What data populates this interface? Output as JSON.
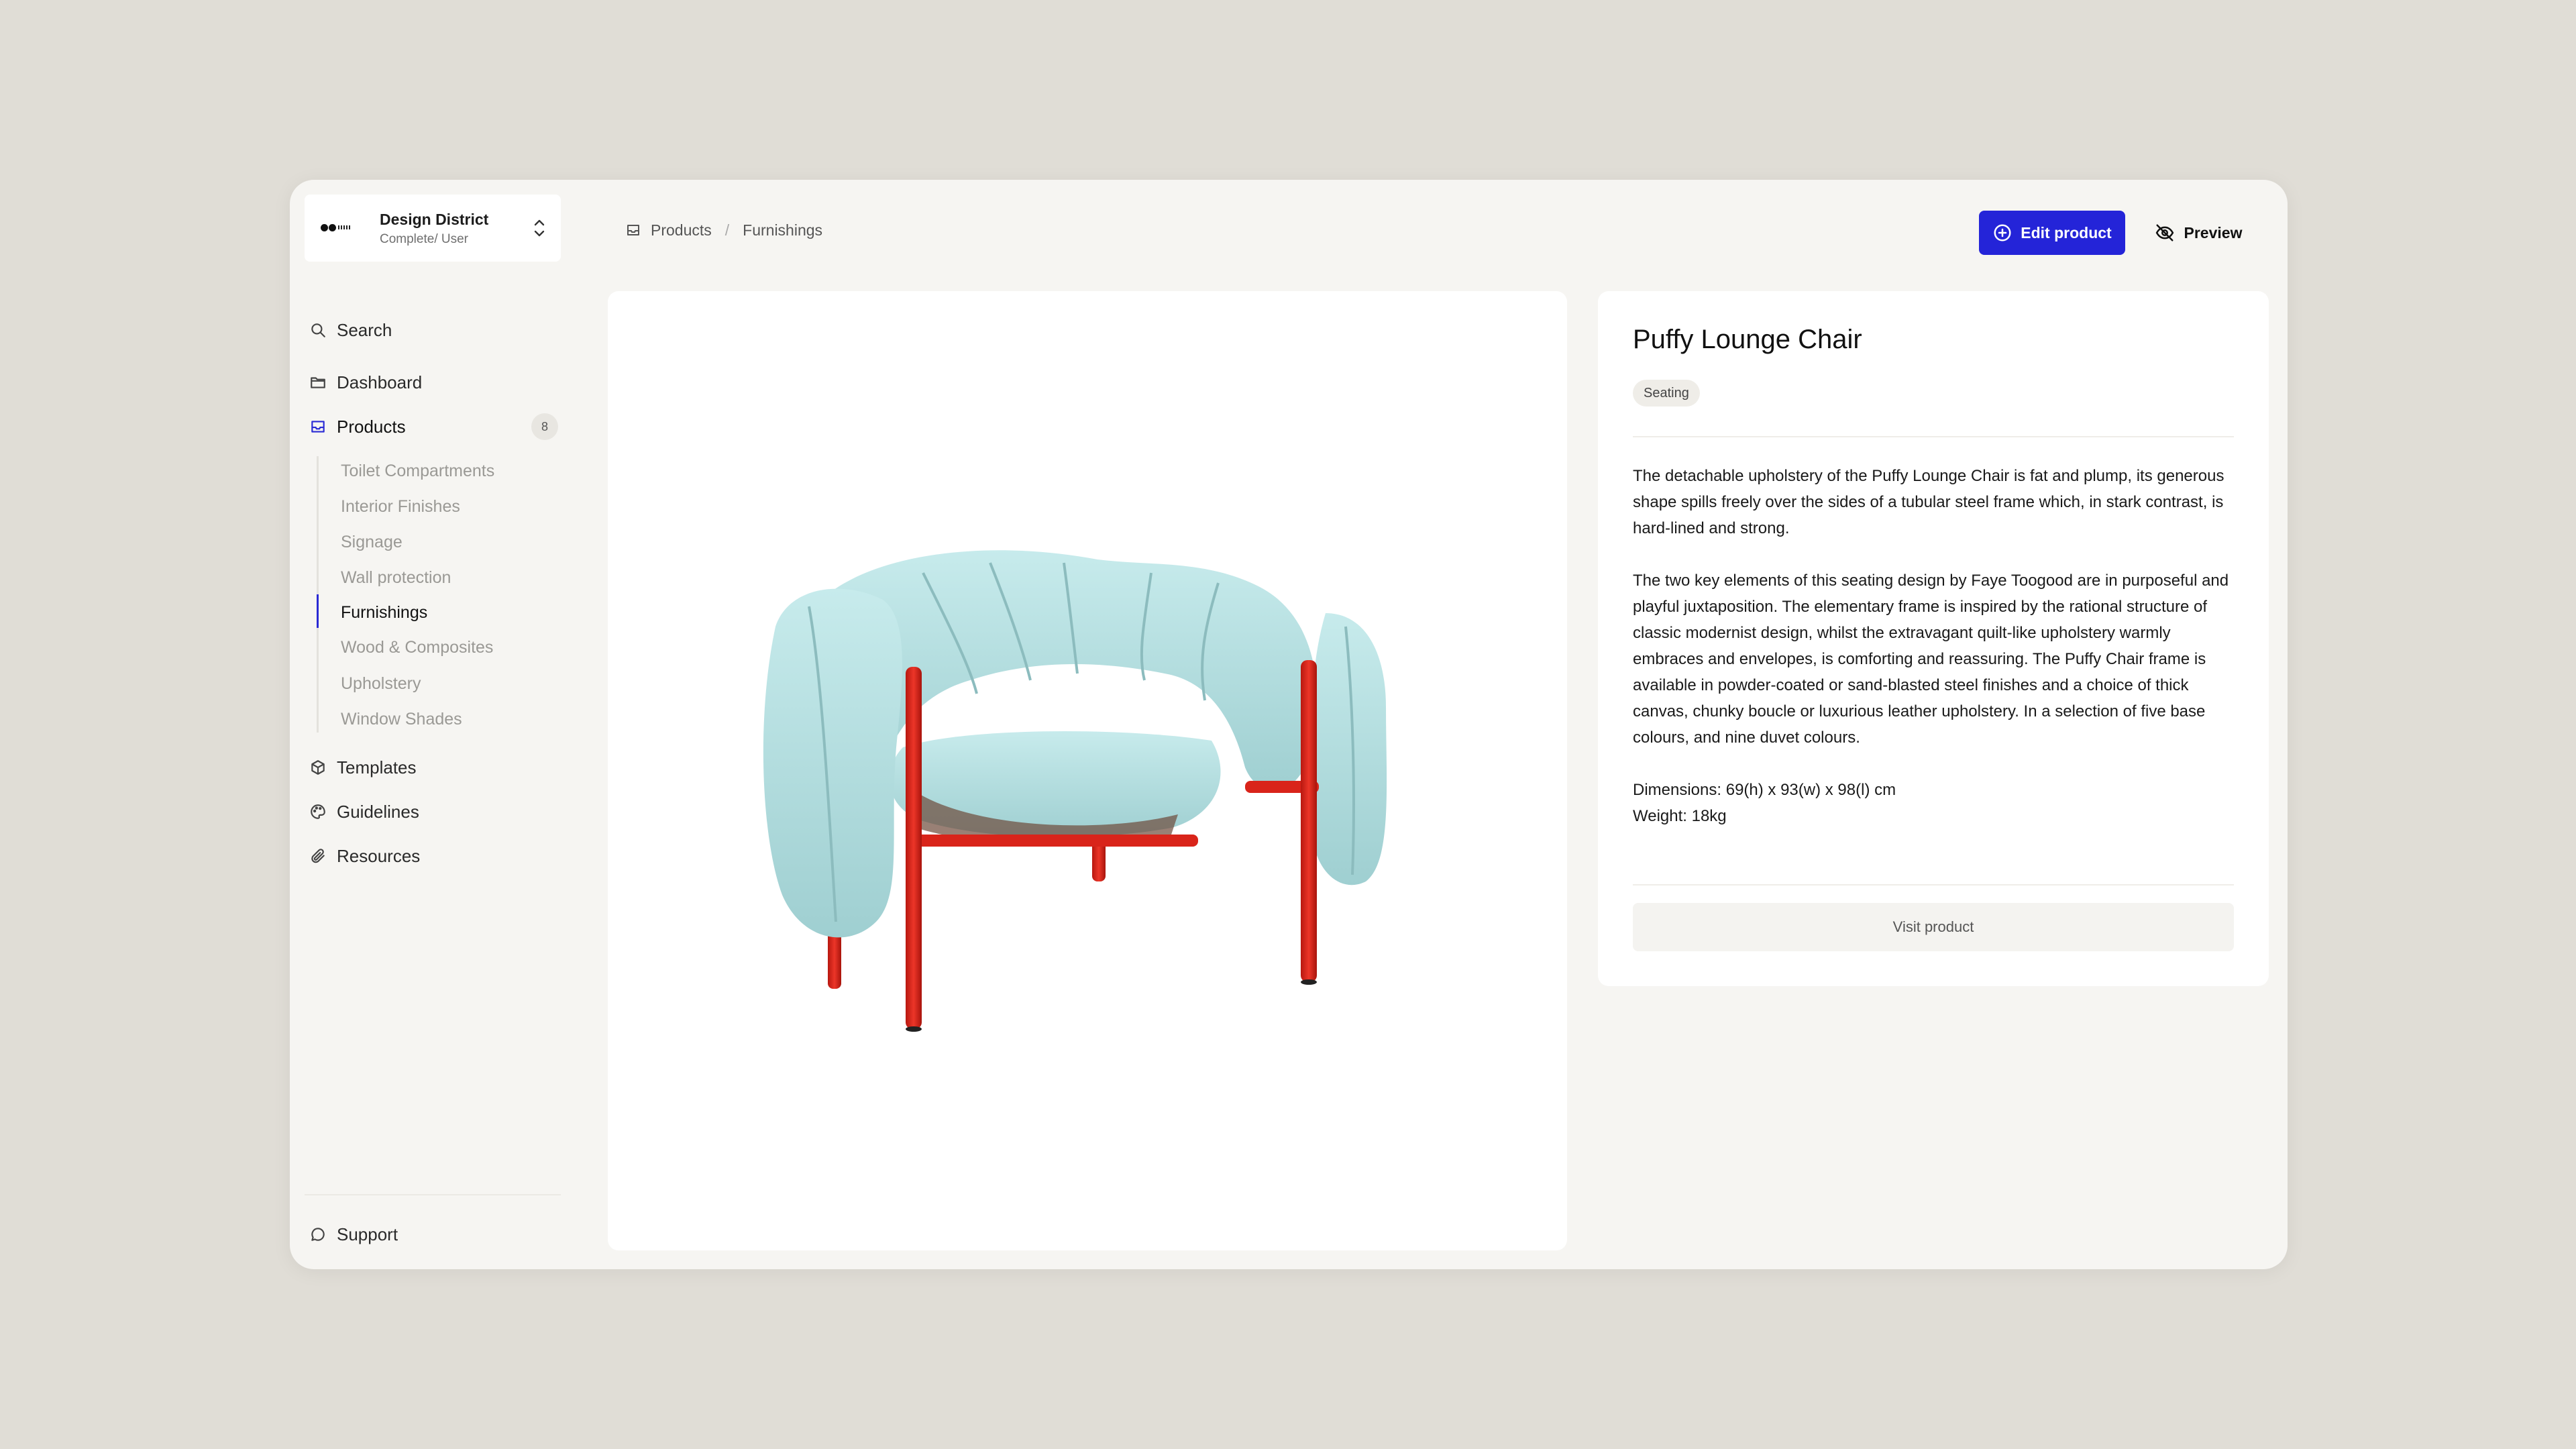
{
  "workspace": {
    "name": "Design District",
    "role": "Complete/ User"
  },
  "nav": {
    "search": "Search",
    "dashboard": "Dashboard",
    "products": "Products",
    "products_count": "8",
    "templates": "Templates",
    "guidelines": "Guidelines",
    "resources": "Resources",
    "support": "Support"
  },
  "product_categories": [
    "Toilet Compartments",
    "Interior Finishes",
    "Signage",
    "Wall protection",
    "Furnishings",
    "Wood & Composites",
    "Upholstery",
    "Window Shades"
  ],
  "active_category": "Furnishings",
  "breadcrumb": [
    "Products",
    "Furnishings"
  ],
  "toolbar": {
    "edit_label": "Edit product",
    "preview_label": "Preview"
  },
  "product": {
    "title": "Puffy Lounge Chair",
    "tag": "Seating",
    "description": [
      "The detachable upholstery of the Puffy Lounge Chair is fat and plump, its generous shape spills freely over the sides of a tubular steel frame which, in stark contrast, is hard-lined and strong.",
      "The two key elements of this seating design by Faye Toogood are in purposeful and playful juxtaposition. The elementary frame is inspired by the rational structure of classic modernist design, whilst the extravagant quilt-like upholstery warmly embraces and envelopes, is comforting and reassuring. The Puffy Chair frame is available in powder-coated or sand-blasted steel finishes and a choice of thick canvas, chunky boucle or luxurious leather upholstery. In a selection of five base colours, and nine duvet colours."
    ],
    "dimensions": "Dimensions: 69(h) x 93(w) x 98(l) cm",
    "weight": "Weight: 18kg",
    "visit_label": "Visit product"
  },
  "colors": {
    "accent": "#2424d8",
    "background": "#e0ddd6",
    "window": "#f6f5f2",
    "chair_upholstery": "#b6dfe0",
    "chair_frame": "#e0281e"
  }
}
